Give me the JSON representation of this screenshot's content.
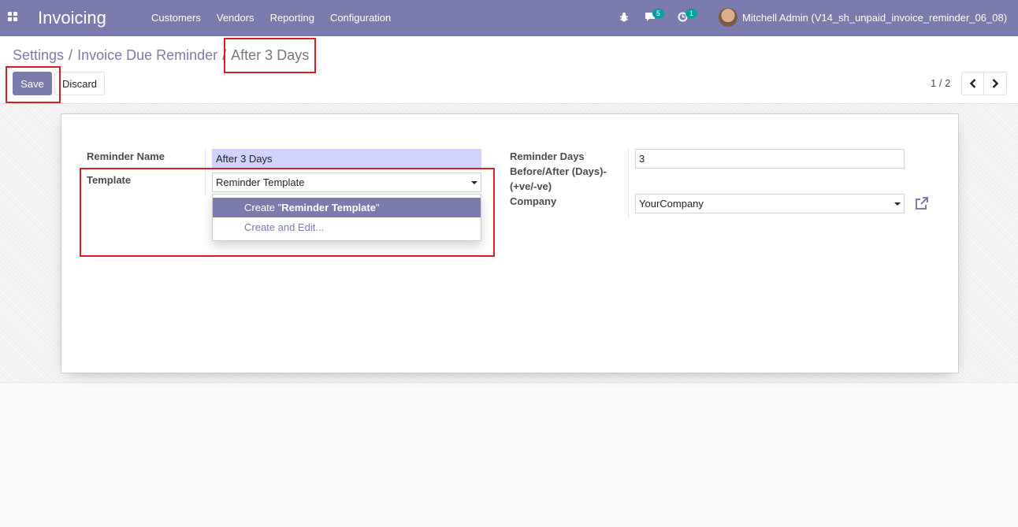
{
  "navbar": {
    "app_title": "Invoicing",
    "menu": [
      "Customers",
      "Vendors",
      "Reporting",
      "Configuration"
    ],
    "messages_count": "5",
    "activities_count": "1",
    "user": "Mitchell Admin (V14_sh_unpaid_invoice_reminder_06_08)"
  },
  "breadcrumb": {
    "items": [
      "Settings",
      "Invoice Due Reminder"
    ],
    "separator": "/",
    "current": "After 3 Days"
  },
  "buttons": {
    "save": "Save",
    "discard": "Discard"
  },
  "pager": {
    "value": "1 / 2"
  },
  "form": {
    "reminder_name_label": "Reminder Name",
    "reminder_name_value": "After 3 Days",
    "template_label": "Template",
    "template_value": "Reminder Template",
    "reminder_days_label_1": "Reminder Days",
    "reminder_days_label_2": "Before/After (Days)-",
    "reminder_days_label_3": "(+ve/-ve)",
    "reminder_days_value": "3",
    "company_label": "Company",
    "company_value": "YourCompany"
  },
  "dropdown": {
    "create_prefix": "Create \"",
    "create_term": "Reminder Template",
    "create_suffix": "\"",
    "create_and_edit": "Create and Edit..."
  },
  "colors": {
    "brand": "#7c7bad",
    "highlight": "#d62026",
    "field_required": "#d2d2ff"
  },
  "icons": [
    "apps-icon",
    "bug-icon",
    "chat-icon",
    "clock-icon",
    "chevron-left-icon",
    "chevron-right-icon",
    "external-link-icon",
    "caret-down-icon"
  ]
}
